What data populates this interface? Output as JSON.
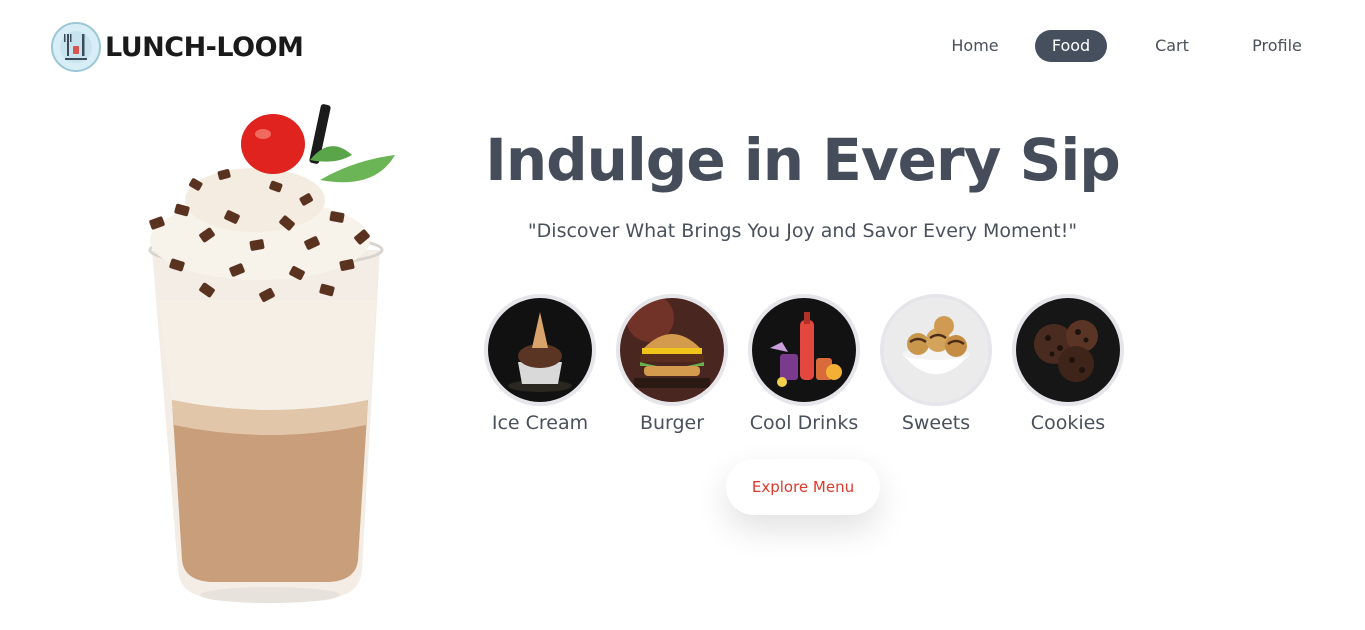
{
  "brand": {
    "name": "LUNCH-LOOM",
    "logo_icon": "fork-knife-logo-icon"
  },
  "nav": {
    "items": [
      {
        "label": "Home",
        "active": false
      },
      {
        "label": "Food",
        "active": true
      },
      {
        "label": "Cart",
        "active": false
      },
      {
        "label": "Profile",
        "active": false
      }
    ]
  },
  "hero": {
    "image": "chocolate-milkshake-image",
    "headline": "Indulge in Every Sip",
    "tagline": "\"Discover What Brings You Joy and Savor Every Moment!\""
  },
  "categories": [
    {
      "label": "Ice Cream",
      "image": "ice-cream-image"
    },
    {
      "label": "Burger",
      "image": "burger-image"
    },
    {
      "label": "Cool Drinks",
      "image": "cool-drinks-image"
    },
    {
      "label": "Sweets",
      "image": "sweets-image"
    },
    {
      "label": "Cookies",
      "image": "cookies-image"
    }
  ],
  "cta": {
    "label": "Explore Menu"
  },
  "colors": {
    "text_dark": "#454d5b",
    "nav_active_bg": "#464f5d",
    "cta_text": "#e0392b",
    "category_border": "#e6e6ea"
  }
}
